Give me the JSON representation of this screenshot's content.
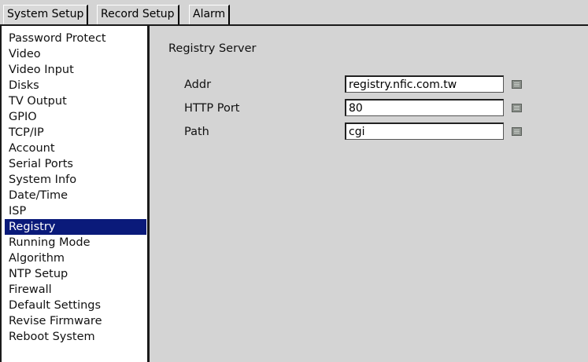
{
  "tabs": [
    {
      "label": "System Setup",
      "active": true
    },
    {
      "label": "Record Setup",
      "active": false
    },
    {
      "label": "Alarm",
      "active": false
    }
  ],
  "sidebar": {
    "selected": "Registry",
    "items": [
      {
        "label": "Password Protect"
      },
      {
        "label": "Video"
      },
      {
        "label": "Video Input"
      },
      {
        "label": "Disks"
      },
      {
        "label": "TV Output"
      },
      {
        "label": "GPIO"
      },
      {
        "label": "TCP/IP"
      },
      {
        "label": "Account"
      },
      {
        "label": "Serial Ports"
      },
      {
        "label": "System Info"
      },
      {
        "label": "Date/Time"
      },
      {
        "label": "ISP"
      },
      {
        "label": "Registry"
      },
      {
        "label": "Running Mode"
      },
      {
        "label": "Algorithm"
      },
      {
        "label": "NTP Setup"
      },
      {
        "label": "Firewall"
      },
      {
        "label": "Default Settings"
      },
      {
        "label": "Revise Firmware"
      },
      {
        "label": "Reboot System"
      }
    ]
  },
  "main": {
    "section_title": "Registry Server",
    "fields": [
      {
        "label": "Addr",
        "value": "registry.nfic.com.tw",
        "icon": "keyboard-icon"
      },
      {
        "label": "HTTP Port",
        "value": "80",
        "icon": "keyboard-icon"
      },
      {
        "label": "Path",
        "value": "cgi",
        "icon": "keyboard-icon"
      }
    ]
  },
  "colors": {
    "selected_bg": "#0a1a7a",
    "panel_bg": "#d4d4d4"
  }
}
